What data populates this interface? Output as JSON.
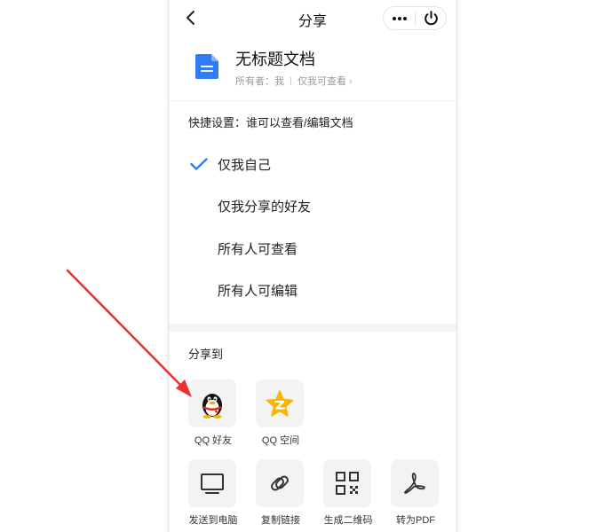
{
  "header": {
    "title": "分享",
    "back_icon": "chevron-left-icon",
    "more_icon": "more-dots-icon",
    "close_icon": "power-icon"
  },
  "document": {
    "icon": "document-icon",
    "title": "无标题文档",
    "owner": "所有者：我",
    "permission": "仅我可查看",
    "accent_color": "#2f7cf6"
  },
  "quick_settings": {
    "label": "快捷设置：谁可以查看/编辑文档",
    "options": [
      {
        "label": "仅我自己",
        "selected": true
      },
      {
        "label": "仅我分享的好友",
        "selected": false
      },
      {
        "label": "所有人可查看",
        "selected": false
      },
      {
        "label": "所有人可编辑",
        "selected": false
      }
    ],
    "check_color": "#2f7cf6"
  },
  "share": {
    "label": "分享到",
    "targets": [
      {
        "label": "QQ 好友",
        "icon": "qq-penguin-icon"
      },
      {
        "label": "QQ 空间",
        "icon": "qzone-star-icon"
      },
      {
        "label": "发送到电脑",
        "icon": "monitor-icon"
      },
      {
        "label": "复制链接",
        "icon": "link-icon"
      },
      {
        "label": "生成二维码",
        "icon": "qr-code-icon"
      },
      {
        "label": "转为PDF",
        "icon": "pdf-icon"
      }
    ]
  },
  "annotation": {
    "arrow_color": "#e8322f"
  }
}
